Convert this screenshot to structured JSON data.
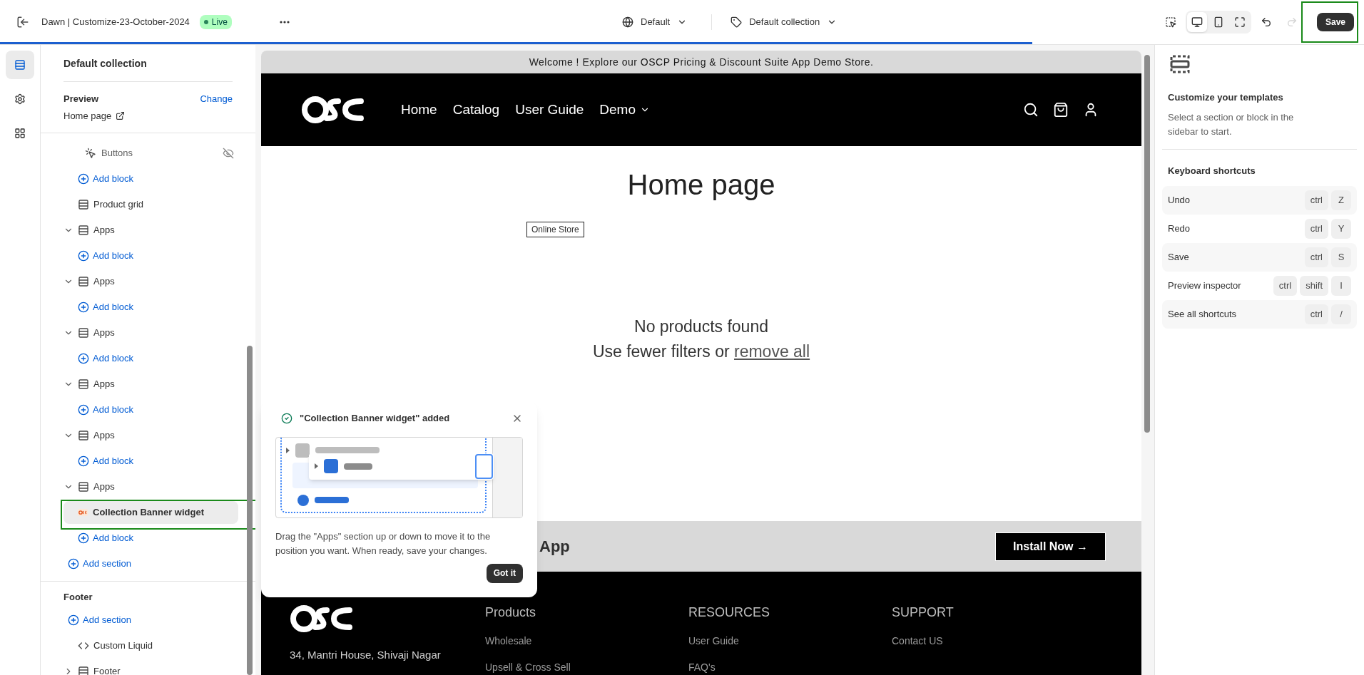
{
  "topbar": {
    "title": "Dawn | Customize-23-October-2024",
    "status": "Live",
    "theme": "Default",
    "template": "Default collection",
    "save": "Save",
    "view_modes": [
      {
        "selected": true
      },
      {
        "selected": false
      },
      {
        "selected": false
      }
    ],
    "redo_disabled": true
  },
  "loading": {
    "level": 0.757
  },
  "rail": [
    {
      "selected": true
    },
    {
      "selected": false
    },
    {
      "selected": false
    }
  ],
  "sidebar": {
    "title": "Default collection",
    "preview_label": "Preview",
    "change_link": "Change",
    "preview_page": "Home page",
    "tree": [
      {
        "kind": "continued",
        "children": [
          {
            "kind": "block",
            "label": "Buttons",
            "hidden": true,
            "selected": false
          },
          {
            "kind": "add_block",
            "label": "Add block"
          }
        ]
      },
      {
        "kind": "section",
        "label": "Product grid"
      },
      {
        "kind": "section",
        "label": "Apps",
        "expanded": true,
        "children": [
          {
            "kind": "add_block",
            "label": "Add block"
          }
        ]
      },
      {
        "kind": "section",
        "label": "Apps",
        "expanded": true,
        "children": [
          {
            "kind": "add_block",
            "label": "Add block"
          }
        ]
      },
      {
        "kind": "section",
        "label": "Apps",
        "expanded": true,
        "children": [
          {
            "kind": "add_block",
            "label": "Add block"
          }
        ]
      },
      {
        "kind": "section",
        "label": "Apps",
        "expanded": true,
        "children": [
          {
            "kind": "add_block",
            "label": "Add block"
          }
        ]
      },
      {
        "kind": "section",
        "label": "Apps",
        "expanded": true,
        "children": [
          {
            "kind": "add_block",
            "label": "Add block"
          }
        ]
      },
      {
        "kind": "section",
        "label": "Apps",
        "expanded": true,
        "children": [
          {
            "kind": "app_block",
            "label": "Collection Banner widget",
            "hidden": false,
            "selected": true
          },
          {
            "kind": "add_block",
            "label": "Add block"
          }
        ]
      },
      {
        "kind": "add_section",
        "label": "Add section"
      }
    ],
    "footer_group": {
      "title": "Footer",
      "items": [
        {
          "kind": "add_section",
          "label": "Add section"
        },
        {
          "kind": "liquid",
          "label": "Custom Liquid"
        },
        {
          "kind": "section",
          "label": "Footer",
          "expanded": false
        }
      ]
    }
  },
  "preview": {
    "announcement": "Welcome ! Explore our OSCP Pricing & Discount Suite App Demo Store.",
    "nav": [
      {
        "label": "Home",
        "dropdown": false
      },
      {
        "label": "Catalog",
        "dropdown": false
      },
      {
        "label": "User Guide",
        "dropdown": false
      },
      {
        "label": "Demo",
        "dropdown": true
      }
    ],
    "page_title": "Home page",
    "badge": "Online Store",
    "empty_title": "No products found",
    "empty_text": "Use fewer filters or ",
    "empty_link": "remove all",
    "banner_text": "App",
    "banner_button": "Install Now →",
    "footer_address": "34, Mantri House, Shivaji Nagar",
    "footer_columns": [
      {
        "title": "Products",
        "links": [
          "Wholesale",
          "Upsell & Cross Sell"
        ]
      },
      {
        "title": "RESOURCES",
        "links": [
          "User Guide",
          "FAQ's"
        ]
      },
      {
        "title": "SUPPORT",
        "links": [
          "Contact US"
        ]
      }
    ]
  },
  "popup": {
    "title": "\"Collection Banner widget\" added",
    "body": "Drag the \"Apps\" section up or down to move it to the position you want. When ready, save your changes.",
    "button": "Got it"
  },
  "inspector": {
    "title": "Customize your templates",
    "subtitle": "Select a section or block in the sidebar to start.",
    "shortcuts_title": "Keyboard shortcuts",
    "shortcuts": [
      {
        "label": "Undo",
        "keys": [
          "ctrl",
          "Z"
        ]
      },
      {
        "label": "Redo",
        "keys": [
          "ctrl",
          "Y"
        ]
      },
      {
        "label": "Save",
        "keys": [
          "ctrl",
          "S"
        ]
      },
      {
        "label": "Preview inspector",
        "keys": [
          "ctrl",
          "shift",
          "I"
        ]
      },
      {
        "label": "See all shortcuts",
        "keys": [
          "ctrl",
          "/"
        ]
      }
    ]
  }
}
